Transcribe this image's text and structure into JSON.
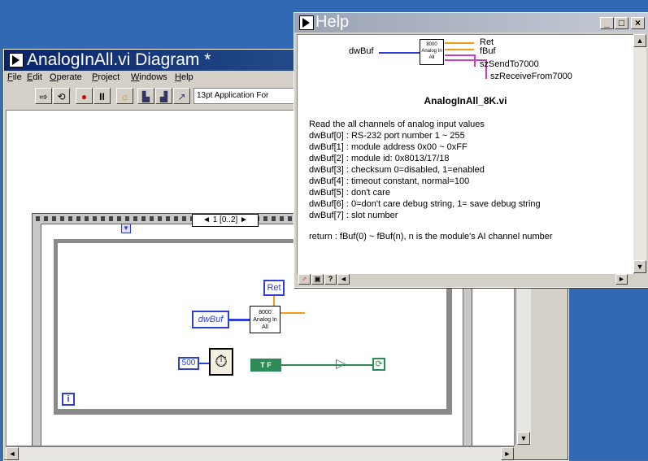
{
  "diagram_window": {
    "title": "AnalogInAll.vi Diagram *",
    "menu": [
      {
        "key": "F",
        "rest": "ile"
      },
      {
        "key": "E",
        "rest": "dit"
      },
      {
        "key": "O",
        "rest": "perate"
      },
      {
        "key": "P",
        "rest": "roject"
      },
      {
        "key": "W",
        "rest": "indows"
      },
      {
        "key": "H",
        "rest": "elp"
      }
    ],
    "toolbar_icons": [
      "arrow-icon",
      "broken-run-icon",
      "abort-icon",
      "pause-icon",
      "highlight-icon",
      "step-icon",
      "step-over-icon",
      "step-out-icon"
    ],
    "font_select": "13pt Application For"
  },
  "diagram": {
    "sequence_selector": "◄ 1 [0..2] ►",
    "node_label_ret": "Ret",
    "control_dwbuf": "dwBuf",
    "subvi_label": "8000 Analog In All",
    "const_500": "500",
    "const_tf": "T F",
    "loop_index": "i"
  },
  "help_window": {
    "title": "Help",
    "connector": {
      "input": "dwBuf",
      "outputs": [
        "Ret",
        "fBuf",
        "szSendTo7000",
        "szReceiveFrom7000"
      ],
      "icon_text": "8000 Analog In All"
    },
    "vi_name": "AnalogInAll_8K.vi",
    "description": [
      "Read the all channels of analog input values",
      "dwBuf[0] : RS-232 port number 1 ~ 255",
      "dwBuf[1] : module address 0x00 ~ 0xFF",
      "dwBuf[2] : module id: 0x8013/17/18",
      "dwBuf[3] : checksum 0=disabled, 1=enabled",
      "dwBuf[4] : timeout constant, normal=100",
      "dwBuf[5] : don't care",
      "dwBuf[6] : 0=don't care debug string, 1= save debug string",
      "dwBuf[7] : slot number"
    ],
    "return_text": "return : fBuf(0) ~ fBuf(n), n is the module's AI channel number",
    "bottom_buttons": [
      "lock-icon",
      "blocks-icon",
      "question-icon"
    ]
  },
  "colors": {
    "title_active": "#0a246a",
    "title_inactive": "#9aa3b5",
    "wire_blue": "#2f3ed6",
    "wire_orange": "#f39c12",
    "wire_green": "#2e8b57"
  }
}
